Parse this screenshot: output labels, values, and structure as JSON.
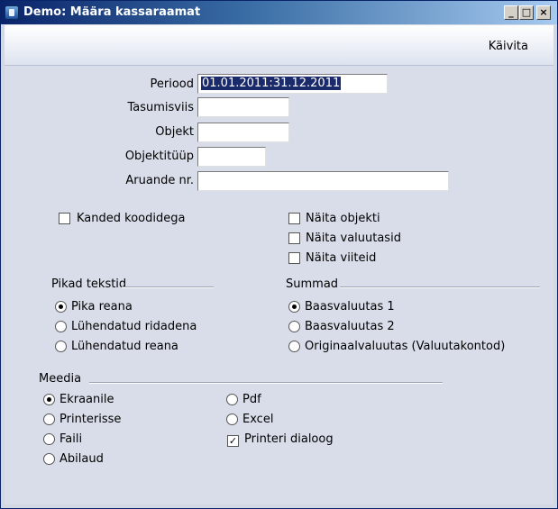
{
  "window": {
    "title": "Demo: Määra kassaraamat",
    "minimize": "_",
    "maximize": "□",
    "close": "×"
  },
  "toolbar": {
    "run_label": "Käivita"
  },
  "fields": {
    "period_label": "Periood",
    "period_value": "01.01.2011:31.12.2011",
    "payment_label": "Tasumisviis",
    "payment_value": "",
    "object_label": "Objekt",
    "object_value": "",
    "object_type_label": "Objektitüüp",
    "object_type_value": "",
    "report_no_label": "Aruande nr.",
    "report_no_value": ""
  },
  "checkboxes": {
    "codes": {
      "label": "Kanded koodidega",
      "checked": false
    },
    "show_objects": {
      "label": "Näita objekti",
      "checked": false
    },
    "show_currencies": {
      "label": "Näita valuutasid",
      "checked": false
    },
    "show_refs": {
      "label": "Näita viiteid",
      "checked": false
    },
    "printer_dialog": {
      "label": "Printeri dialoog",
      "checked": true
    }
  },
  "long_texts": {
    "title": "Pikad tekstid",
    "options": [
      "Pika reana",
      "Lühendatud ridadena",
      "Lühendatud reana"
    ],
    "selected": 0
  },
  "sums": {
    "title": "Summad",
    "options": [
      "Baasvaluutas 1",
      "Baasvaluutas 2",
      "Originaalvaluutas (Valuutakontod)"
    ],
    "selected": 0
  },
  "media": {
    "title": "Meedia",
    "options": [
      "Ekraanile",
      "Printerisse",
      "Faili",
      "Abilaud",
      "Pdf",
      "Excel"
    ],
    "selected": 0
  },
  "colors": {
    "title_start": "#0a246a",
    "title_end": "#a6caf0",
    "selection": "#1b2a6b"
  }
}
